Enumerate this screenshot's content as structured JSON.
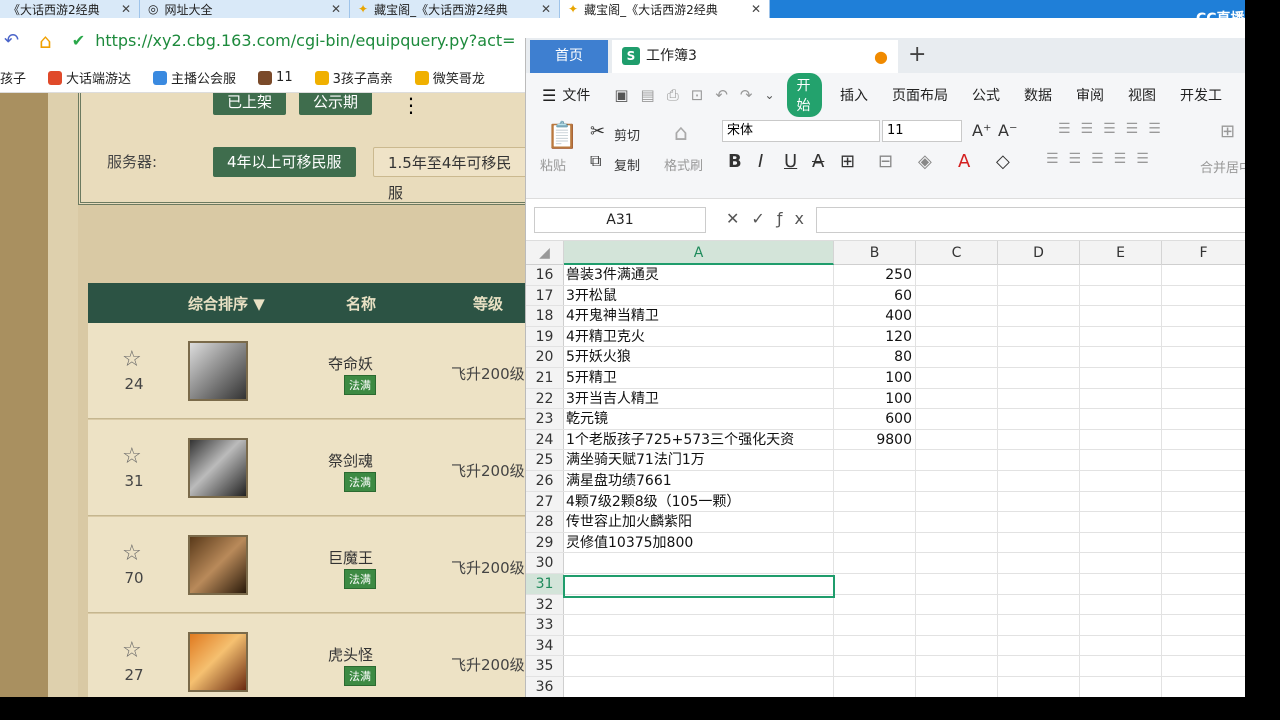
{
  "browser": {
    "tabs": [
      {
        "label": "《大话西游2经典",
        "active": false
      },
      {
        "label": "网址大全",
        "active": false
      },
      {
        "label": "藏宝阁_《大话西游2经典",
        "active": false
      },
      {
        "label": "藏宝阁_《大话西游2经典",
        "active": true
      }
    ],
    "url": "https://xy2.cbg.163.com/cgi-bin/equipquery.py?act=",
    "bookmarks": [
      "孩子",
      "大话端游达",
      "主播公会服",
      "11",
      "3孩子高亲",
      "微笑哥龙"
    ]
  },
  "stream_logo": "CC直播",
  "webpage": {
    "server_label": "服务器:",
    "filter_top": [
      "已上架",
      "公示期"
    ],
    "server_options": [
      "4年以上可移民服",
      "1.5年至4年可移民服"
    ],
    "list_headers": [
      "综合排序 ▼",
      "名称",
      "等级"
    ],
    "rows": [
      {
        "favorites": "24",
        "name": "夺命妖",
        "tag": "法满",
        "level": "飞升200级"
      },
      {
        "favorites": "31",
        "name": "祭剑魂",
        "tag": "法满",
        "level": "飞升200级"
      },
      {
        "favorites": "70",
        "name": "巨魔王",
        "tag": "法满",
        "level": "飞升200级"
      },
      {
        "favorites": "27",
        "name": "虎头怪",
        "tag": "法满",
        "level": "飞升200级"
      }
    ]
  },
  "wps": {
    "home_tab": "首页",
    "workbook_tab": "工作簿3",
    "menu": [
      "文件",
      "开始",
      "插入",
      "页面布局",
      "公式",
      "数据",
      "审阅",
      "视图",
      "开发工"
    ],
    "ribbon": {
      "paste": "粘贴",
      "cut": "剪切",
      "copy": "复制",
      "format_painter": "格式刷",
      "font_name": "宋体",
      "font_size": "11",
      "merge": "合并居中"
    },
    "name_box": "A31",
    "formula": "",
    "columns": [
      "A",
      "B",
      "C",
      "D",
      "E",
      "F"
    ],
    "rows": [
      {
        "n": "16",
        "a": "兽装3件满通灵",
        "b": "250"
      },
      {
        "n": "17",
        "a": "3开松鼠",
        "b": "60"
      },
      {
        "n": "18",
        "a": "4开鬼神当精卫",
        "b": "400"
      },
      {
        "n": "19",
        "a": "4开精卫克火",
        "b": "120"
      },
      {
        "n": "20",
        "a": "5开妖火狼",
        "b": "80"
      },
      {
        "n": "21",
        "a": "5开精卫",
        "b": "100"
      },
      {
        "n": "22",
        "a": "3开当吉人精卫",
        "b": "100"
      },
      {
        "n": "23",
        "a": "乾元镜",
        "b": "600"
      },
      {
        "n": "24",
        "a": "1个老版孩子725+573三个强化天资",
        "b": "9800"
      },
      {
        "n": "25",
        "a": "满坐骑天赋71法门1万",
        "b": ""
      },
      {
        "n": "26",
        "a": "满星盘功绩7661",
        "b": ""
      },
      {
        "n": "27",
        "a": "4颗7级2颗8级（105一颗）",
        "b": ""
      },
      {
        "n": "28",
        "a": "传世容止加火麟紫阳",
        "b": ""
      },
      {
        "n": "29",
        "a": "灵修值10375加800",
        "b": ""
      },
      {
        "n": "30",
        "a": "",
        "b": ""
      },
      {
        "n": "31",
        "a": "",
        "b": ""
      },
      {
        "n": "32",
        "a": "",
        "b": ""
      },
      {
        "n": "33",
        "a": "",
        "b": ""
      },
      {
        "n": "34",
        "a": "",
        "b": ""
      },
      {
        "n": "35",
        "a": "",
        "b": ""
      },
      {
        "n": "36",
        "a": "",
        "b": ""
      }
    ]
  }
}
